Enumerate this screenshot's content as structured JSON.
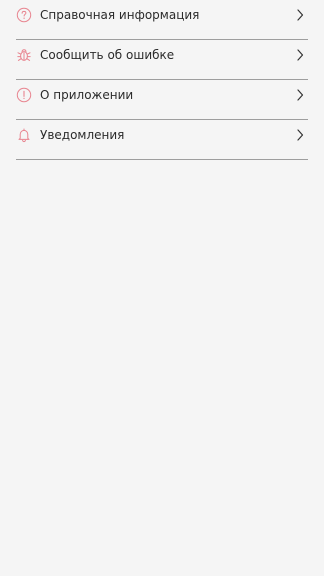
{
  "accent_color": "#e8848f",
  "menu": {
    "items": [
      {
        "label": "Справочная информация",
        "icon": "question-circle-icon"
      },
      {
        "label": "Сообщить об ошибке",
        "icon": "bug-icon"
      },
      {
        "label": "О приложении",
        "icon": "info-circle-icon"
      },
      {
        "label": "Уведомления",
        "icon": "bell-icon"
      }
    ]
  }
}
